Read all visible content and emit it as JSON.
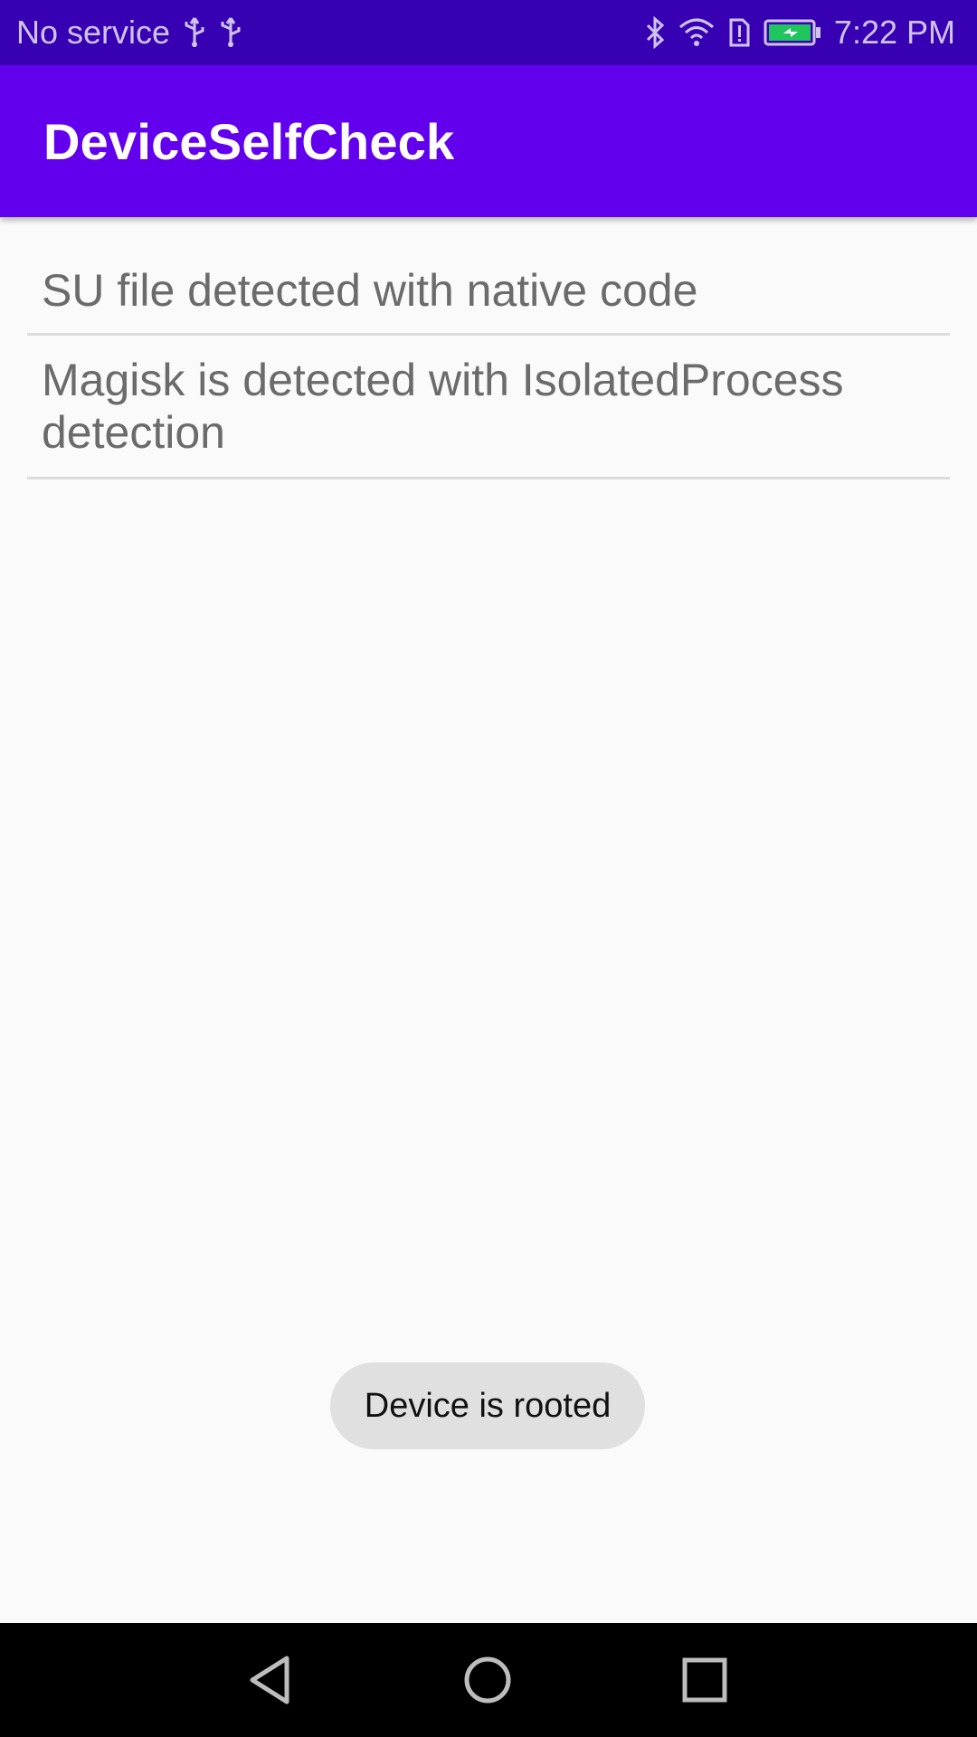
{
  "status_bar": {
    "carrier": "No service",
    "time": "7:22 PM",
    "icons": [
      "usb-icon",
      "usb-icon",
      "bluetooth-icon",
      "wifi-icon",
      "sim-alert-icon",
      "battery-charging-icon"
    ],
    "battery_color": "#21c55d"
  },
  "app_bar": {
    "title": "DeviceSelfCheck",
    "color": "#6200ee"
  },
  "list": {
    "items": [
      {
        "label": "SU file detected with native code"
      },
      {
        "label": "Magisk is detected with IsolatedProcess detection"
      }
    ]
  },
  "toast": {
    "message": "Device is rooted"
  },
  "nav_bar": {
    "icons": [
      "back-icon",
      "home-icon",
      "recents-icon"
    ]
  }
}
